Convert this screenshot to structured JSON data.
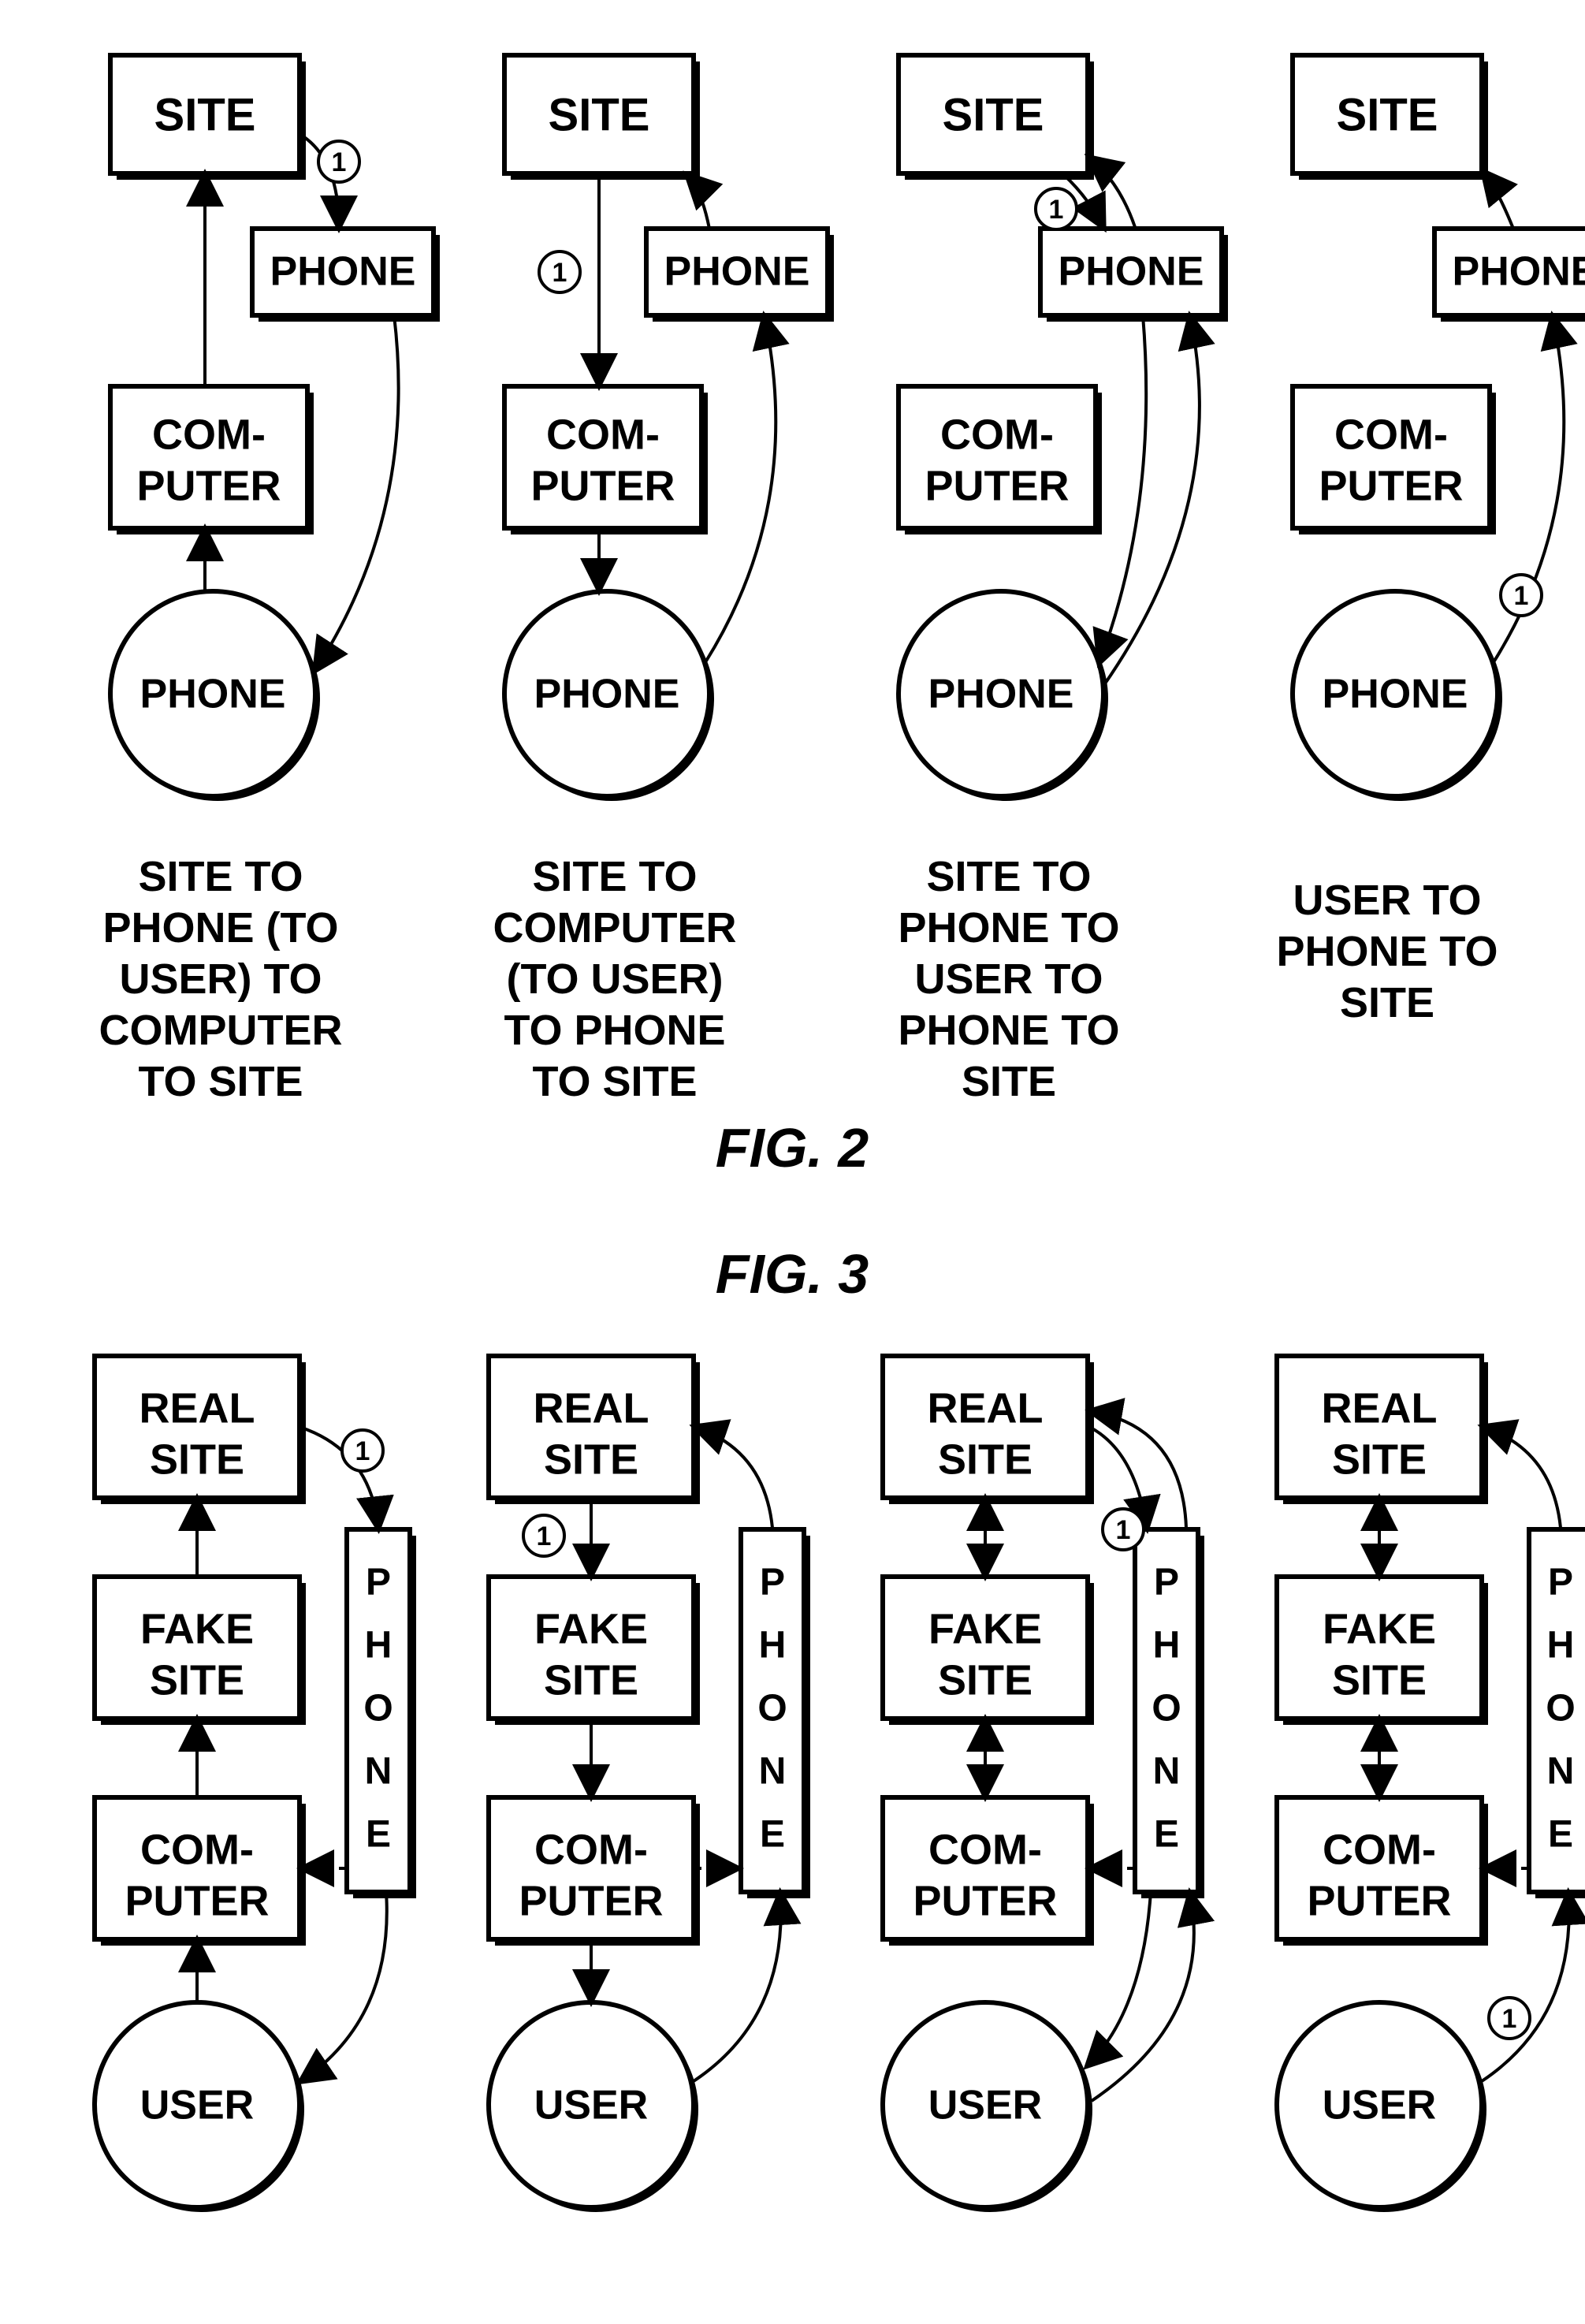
{
  "labels": {
    "site": "SITE",
    "phone": "PHONE",
    "computer1": "COM-",
    "computer2": "PUTER",
    "realsite1": "REAL",
    "realsite2": "SITE",
    "fakesite1": "FAKE",
    "fakesite2": "SITE",
    "user": "USER",
    "badge": "1",
    "phoneV0": "P",
    "phoneV1": "H",
    "phoneV2": "O",
    "phoneV3": "N",
    "phoneV4": "E"
  },
  "figures": {
    "fig2": "FIG. 2",
    "fig3": "FIG. 3"
  },
  "captions": {
    "c0l0": "SITE TO",
    "c0l1": "PHONE (TO",
    "c0l2": "USER) TO",
    "c0l3": "COMPUTER",
    "c0l4": "TO SITE",
    "c1l0": "SITE TO",
    "c1l1": "COMPUTER",
    "c1l2": "(TO USER)",
    "c1l3": "TO PHONE",
    "c1l4": "TO SITE",
    "c2l0": "SITE TO",
    "c2l1": "PHONE TO",
    "c2l2": "USER TO",
    "c2l3": "PHONE TO",
    "c2l4": "SITE",
    "c3l0": "USER TO",
    "c3l1": "PHONE TO",
    "c3l2": "SITE"
  }
}
